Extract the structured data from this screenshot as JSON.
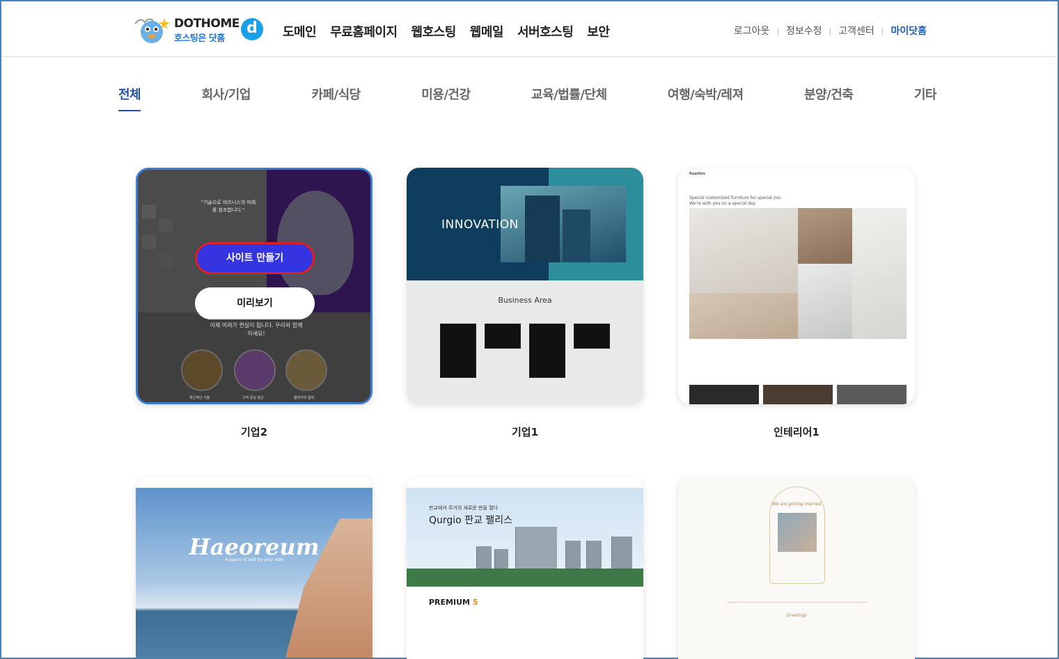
{
  "header": {
    "logo_title": "DOTHOME",
    "logo_sub": "호스팅은 닷홈",
    "logo_mark": "d",
    "nav": [
      "도메인",
      "무료홈페이지",
      "웹호스팅",
      "웹메일",
      "서버호스팅",
      "보안"
    ],
    "util": {
      "logout": "로그아웃",
      "edit_info": "정보수정",
      "support": "고객센터",
      "mypage": "마이닷홈"
    }
  },
  "categories": [
    "전체",
    "회사/기업",
    "카페/식당",
    "미용/건강",
    "교육/법률/단체",
    "여행/숙박/레져",
    "분양/건축",
    "기타"
  ],
  "active_category": "전체",
  "templates": {
    "t1": {
      "label": "기업2",
      "make_button": "사이트 만들기",
      "preview_button": "미리보기",
      "quote": "\"기술으로 비즈니스의 미래를 창조합니다.\"",
      "sub": "이제 미래가 현실이 됩니다. 우리와 함께하세요!",
      "icons": [
        "혁신적인 기술",
        "고객 중심 접근",
        "협력가의 협력"
      ]
    },
    "t2": {
      "label": "기업1",
      "hero_title": "INNOVATION",
      "section_title": "Business Area"
    },
    "t3": {
      "label": "인테리어1",
      "brand": "Realthis",
      "tagline": "Special customized furniture for special you",
      "tagline2": "We're with you on a special day"
    },
    "t4": {
      "title": "Haeoreum",
      "sub": "A space of rest by your side"
    },
    "t5": {
      "brand": "Qurgio 판교 팰리스",
      "headline": "판교에서 주거의 새로운 판을 열다",
      "premium": "PREMIUM",
      "premium_num": "5"
    },
    "t6": {
      "heading": "We are getting married",
      "greet": "Greetings"
    }
  },
  "colors": {
    "accent": "#1f4fa8",
    "make_button": "#3434e0",
    "highlight_border": "#e02020"
  }
}
